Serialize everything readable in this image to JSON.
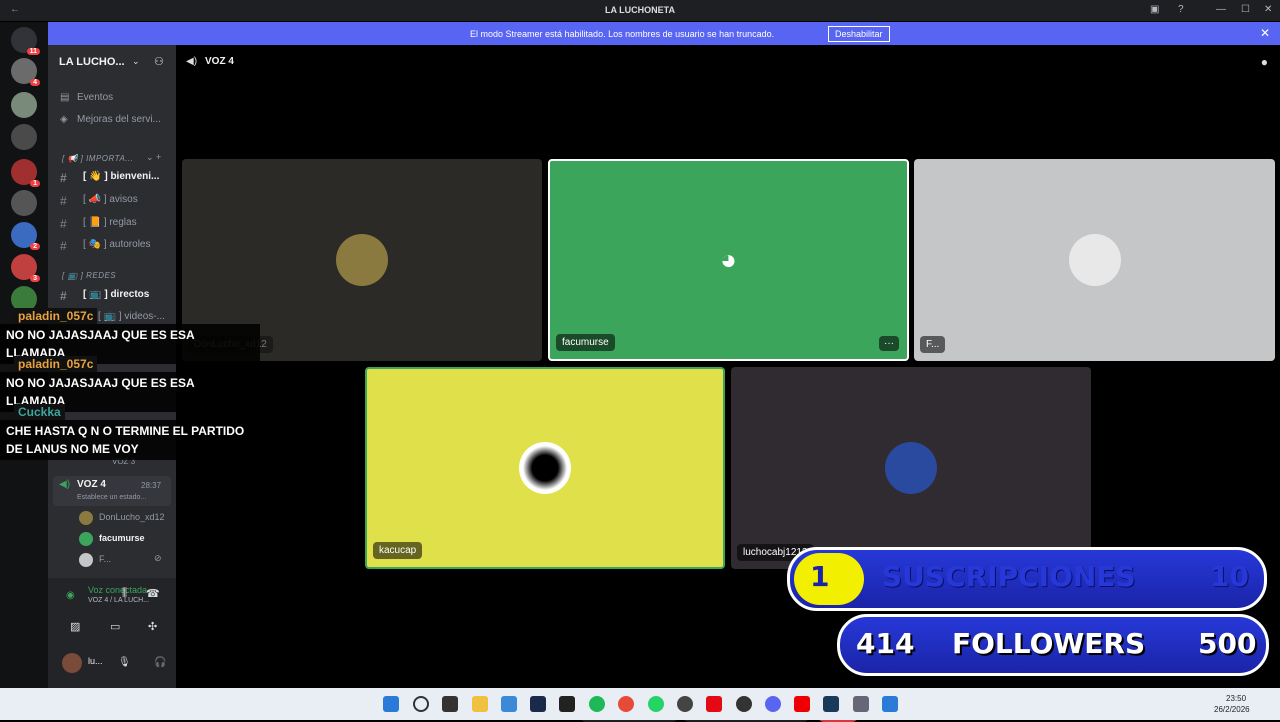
{
  "window": {
    "title": "LA LUCHONETA",
    "back": "←"
  },
  "banner": {
    "message": "El modo Streamer está habilitado. Los nombres de usuario se han truncado.",
    "button": "Deshabilitar",
    "close": "✕"
  },
  "server": {
    "name": "LA LUCHO..."
  },
  "sidebar": {
    "events": "Eventos",
    "boosts": "Mejoras del servi...",
    "cat_importante": "[ 📢 ] IMPORTA...",
    "channels": [
      {
        "label": "[ 👋 ] bienveni...",
        "icon": "#"
      },
      {
        "label": "[ 📣 ] avisos",
        "icon": "#"
      },
      {
        "label": "[ 📙 ] reglas",
        "icon": "#"
      },
      {
        "label": "[ 🎭 ] autoroles",
        "icon": "#"
      }
    ],
    "cat_redes": "[ 📺 ] REDES",
    "directos": "[ 📺 ] directos",
    "videos": "[ 📺 ] videos-...",
    "voz3": "VOZ 3",
    "voz4": "VOZ 4",
    "voz4_time": "28:37",
    "voz4_status": "Establece un estado...",
    "members": [
      "DonLucho_xd12",
      "facumurse",
      "F..."
    ]
  },
  "userpanel": {
    "status": "Voz conectada",
    "location": "VOZ 4 / LA LUCH...",
    "user": "lu..."
  },
  "voice": {
    "channel": "VOZ 4"
  },
  "tiles": [
    {
      "name": "DonLucho_xd12",
      "bg": "#2b2a27"
    },
    {
      "name": "facumurse",
      "bg": "#3ba55c"
    },
    {
      "name": "F...",
      "bg": "#c4c6c8"
    },
    {
      "name": "kacucap",
      "bg": "#e0e04a"
    },
    {
      "name": "luchocabj1212",
      "bg": "#302b30"
    }
  ],
  "chat": [
    {
      "user": "paladin_057c",
      "text": "NO NO JAJASJAAJ QUE ES ESA LLAMADA"
    },
    {
      "user": "paladin_057c",
      "text": "NO NO JAJASJAAJ QUE ES ESA LLAMADA"
    },
    {
      "user": "Cuckka",
      "text": "CHE HASTA Q N O TERMINE EL PARTIDO DE LANUS NO ME VOY"
    }
  ],
  "overlay": {
    "subs_current": "1",
    "subs_label": "SUSCRIPCIONES",
    "subs_goal": "10",
    "subs_progress": 0.1,
    "followers_current": "414",
    "followers_label": "FOLLOWERS",
    "followers_goal": "500",
    "followers_progress": 0.828
  },
  "controls": {
    "more": "···"
  },
  "clock": {
    "time": "23:50",
    "date": "26/2/2026"
  },
  "colors": {
    "blurple": "#5865f2",
    "green": "#3ba55c",
    "yellow": "#e0e04a",
    "red": "#da373c"
  }
}
